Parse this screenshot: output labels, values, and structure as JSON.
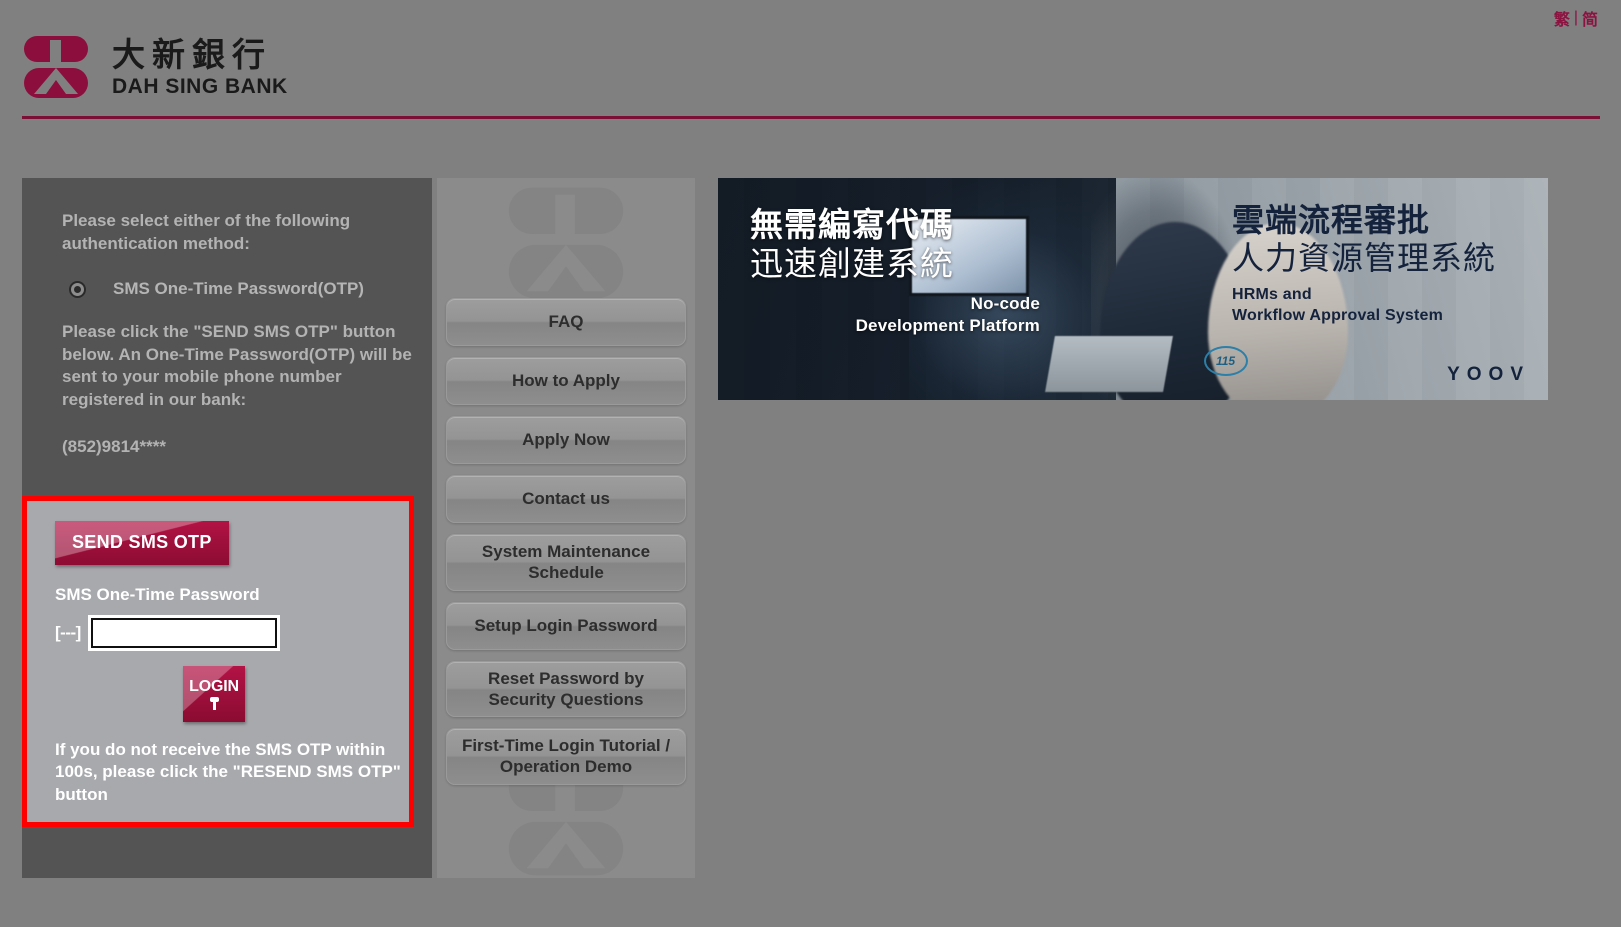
{
  "lang_bar": {
    "traditional": "繁",
    "separator": "|",
    "simplified": "简"
  },
  "header": {
    "logo_cn": "大新銀行",
    "logo_en": "DAH SING BANK"
  },
  "auth_panel": {
    "lede": "Please select either of the following authentication method:",
    "radio_label": "SMS One-Time Password(OTP)",
    "instruction": "Please click the \"SEND SMS OTP\" button below. An One-Time Password(OTP) will be sent to your mobile phone number registered in our bank:",
    "phone": "(852)9814****"
  },
  "otp_block": {
    "send_button": "SEND SMS OTP",
    "field_label": "SMS One-Time Password",
    "prefix": "[---]",
    "input_value": "",
    "input_placeholder": "",
    "login_button": "LOGIN",
    "note": "If you do not receive the SMS OTP within 100s, please click the \"RESEND SMS OTP\" button",
    "highlight_color": "#ff0000"
  },
  "menu": {
    "items": [
      {
        "label": "FAQ"
      },
      {
        "label": "How to Apply"
      },
      {
        "label": "Apply Now"
      },
      {
        "label": "Contact us"
      },
      {
        "label": "System Maintenance Schedule"
      },
      {
        "label": "Setup Login Password"
      },
      {
        "label": "Reset Password by Security Questions"
      },
      {
        "label": "First-Time Login Tutorial / Operation Demo"
      }
    ]
  },
  "banner": {
    "left_cn_line1": "無需編寫代碼",
    "left_cn_line2": "迅速創建系統",
    "left_en_line1": "No-code",
    "left_en_line2": "Development Platform",
    "right_cn_line1": "雲端流程審批",
    "right_cn_line2": "人力資源管理系統",
    "right_en_line1": "HRMs and",
    "right_en_line2": "Workflow Approval System",
    "brand": "YOOV",
    "badge": "115"
  },
  "colors": {
    "brand_maroon": "#7c0f36",
    "button_crimson": "#9c0f3b",
    "page_background": "#808080"
  }
}
